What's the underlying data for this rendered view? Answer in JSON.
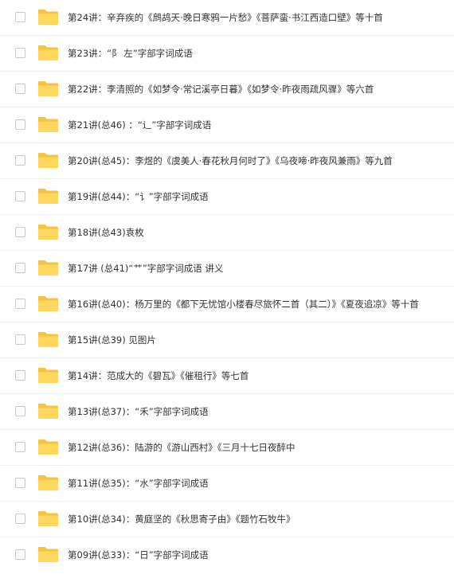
{
  "colors": {
    "folder_back": "#f5c242",
    "folder_front": "#ffd75e",
    "text": "#333333",
    "separator": "#f0f0f2",
    "checkbox_border": "#c8c8cc"
  },
  "icons": {
    "folder": "folder-icon",
    "checkbox": "checkbox"
  },
  "files": [
    "第24讲：辛弃疾的《鹧鸪天·晚日寒鸦一片愁》《菩萨蛮·书江西造口壁》等十首",
    "第23讲：“阝 左”字部字词成语",
    "第22讲：李清照的《如梦令·常记溪亭日暮》《如梦令·昨夜雨疏风骤》等六首",
    "第21讲(总46) ：“辶”字部字词成语",
    "第20讲(总45)：李煜的《虞美人·春花秋月何时了》《乌夜啼·昨夜风兼雨》等九首",
    "第19讲(总44)：“讠”字部字词成语",
    "第18讲(总43)袁枚",
    "第17讲 (总41)“艹”字部字词成语 讲义",
    "第16讲(总40)：杨万里的《都下无忧馆小楼春尽旅怀二首（其二）》《夏夜追凉》等十首",
    "第15讲(总39) 见图片",
    "第14讲：范成大的《碧瓦》《催租行》等七首",
    "第13讲(总37)：“禾”字部字词成语",
    "第12讲(总36)：陆游的《游山西村》《三月十七日夜醉中",
    "第11讲(总35)：“水”字部字词成语",
    "第10讲(总34)：黄庭坚的《秋思寄子由》《题竹石牧牛》",
    "第09讲(总33)：“日”字部字词成语"
  ]
}
